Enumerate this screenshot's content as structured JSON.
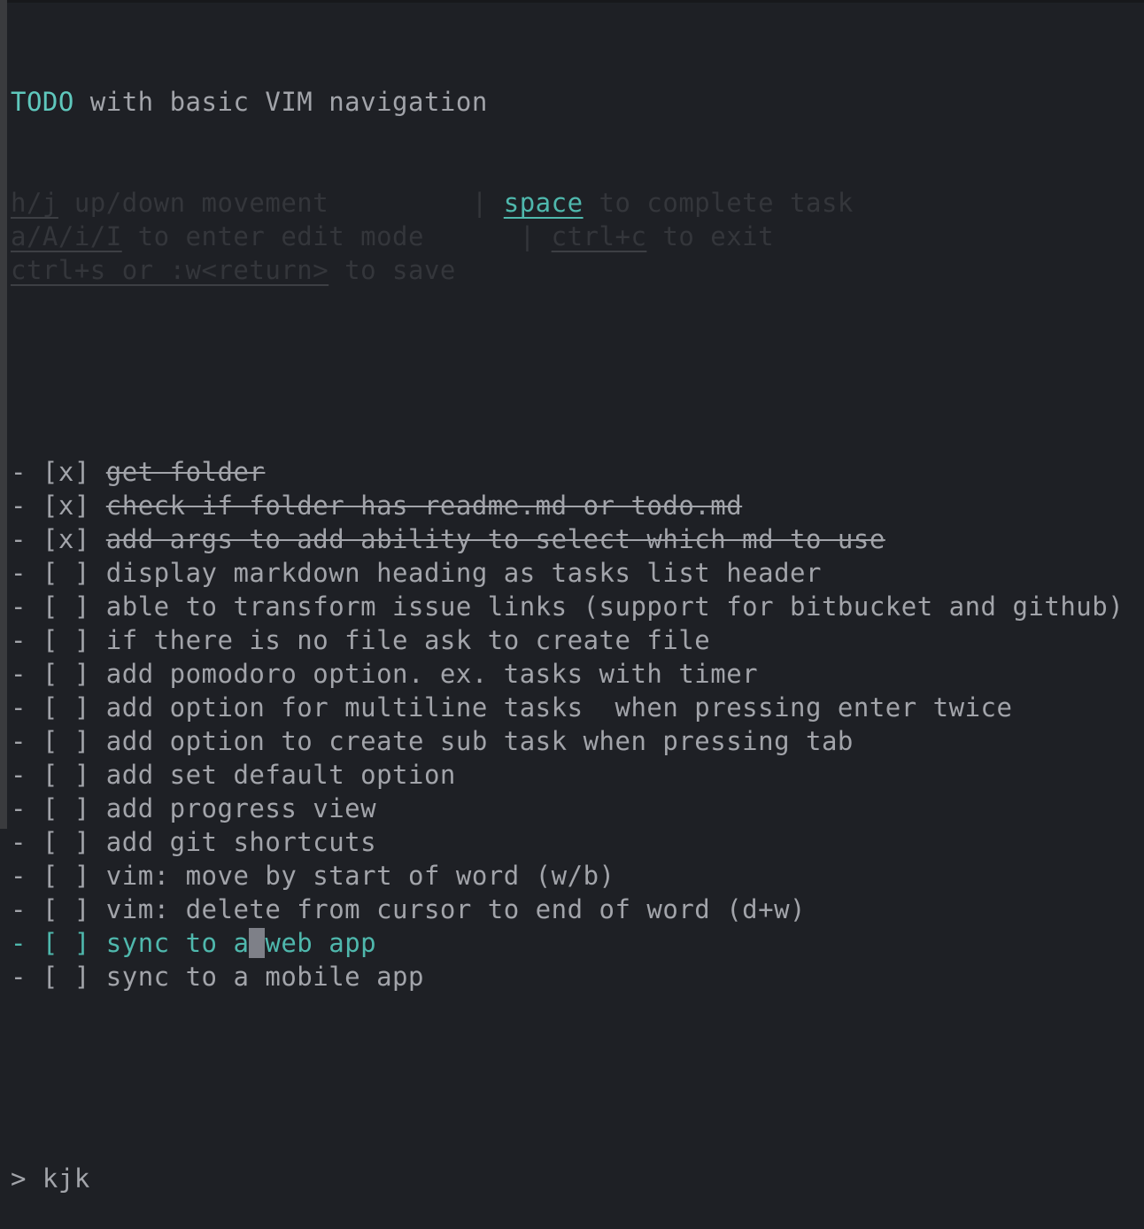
{
  "header": {
    "title_accent": "TODO",
    "title_rest": " with basic VIM navigation"
  },
  "help": [
    {
      "key": "h/j",
      "desc": " up/down movement         ",
      "sep": "| ",
      "key2": "space",
      "desc2": " to complete task",
      "key2_accent": true
    },
    {
      "key": "a/A/i/I",
      "desc": " to enter edit mode      ",
      "sep": "| ",
      "key2": "ctrl+c",
      "desc2": " to exit",
      "key2_accent": false
    },
    {
      "key": "ctrl+s or :w<return>",
      "desc": " to save",
      "sep": "",
      "key2": "",
      "desc2": "",
      "key2_accent": false
    }
  ],
  "tasks": [
    {
      "bullet": "- ",
      "checkbox": "[x]",
      "text": "get folder",
      "done": true
    },
    {
      "bullet": "- ",
      "checkbox": "[x]",
      "text": "check if folder has readme.md or todo.md",
      "done": true
    },
    {
      "bullet": "- ",
      "checkbox": "[x]",
      "text": "add args to add ability to select which md to use",
      "done": true
    },
    {
      "bullet": "- ",
      "checkbox": "[ ]",
      "text": "display markdown heading as tasks list header",
      "done": false
    },
    {
      "bullet": "- ",
      "checkbox": "[ ]",
      "text": "able to transform issue links (support for bitbucket and github)",
      "done": false
    },
    {
      "bullet": "- ",
      "checkbox": "[ ]",
      "text": "if there is no file ask to create file",
      "done": false
    },
    {
      "bullet": "- ",
      "checkbox": "[ ]",
      "text": "add pomodoro option. ex. tasks with timer",
      "done": false
    },
    {
      "bullet": "- ",
      "checkbox": "[ ]",
      "text": "add option for multiline tasks  when pressing enter twice",
      "done": false
    },
    {
      "bullet": "- ",
      "checkbox": "[ ]",
      "text": "add option to create sub task when pressing tab",
      "done": false
    },
    {
      "bullet": "- ",
      "checkbox": "[ ]",
      "text": "add set default option",
      "done": false
    },
    {
      "bullet": "- ",
      "checkbox": "[ ]",
      "text": "add progress view",
      "done": false
    },
    {
      "bullet": "- ",
      "checkbox": "[ ]",
      "text": "add git shortcuts",
      "done": false
    },
    {
      "bullet": "- ",
      "checkbox": "[ ]",
      "text": "vim: move by start of word (w/b)",
      "done": false
    },
    {
      "bullet": "- ",
      "checkbox": "[ ]",
      "text": "vim: delete from cursor to end of word (d+w)",
      "done": false
    },
    {
      "bullet": "- ",
      "checkbox": "[ ]",
      "text": "sync to a web app",
      "done": false,
      "selected": true,
      "cursor_index": 9
    },
    {
      "bullet": "- ",
      "checkbox": "[ ]",
      "text": "sync to a mobile app",
      "done": false
    }
  ],
  "command": {
    "prompt": "> ",
    "value": "kjk"
  },
  "colors": {
    "background": "#1e2025",
    "accent": "#5fc8bd",
    "text": "#a2a4aa",
    "dim": "#34363b",
    "cursor": "#7e8088"
  }
}
